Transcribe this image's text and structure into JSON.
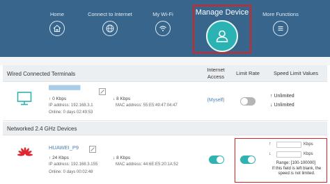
{
  "nav": {
    "items": [
      {
        "label": "Home",
        "icon": "home-icon"
      },
      {
        "label": "Connect to Internet",
        "icon": "globe-icon"
      },
      {
        "label": "My Wi-Fi",
        "icon": "wifi-icon"
      },
      {
        "label": "Manage Device",
        "icon": "user-icon"
      },
      {
        "label": "More Functions",
        "icon": "menu-icon"
      }
    ]
  },
  "table": {
    "columns": {
      "internet_access": "Internet Access",
      "limit_rate": "Limit Rate",
      "speed_limit_values": "Speed Limit Values"
    },
    "sections": [
      {
        "title": "Wired Connected Terminals",
        "devices": [
          {
            "name": "████████████",
            "icon": "monitor-icon",
            "upload": "0 Kbps",
            "download": "8 Kbps",
            "ip_label": "IP address: 192.168.3.1",
            "mac_label": "MAC address: 55:E5:49:47:04:47",
            "online_label": "Online:  0 days 02:49:53",
            "internet_access": "(Myself)",
            "limit_rate_on": false,
            "speed_up": "Unlimited",
            "speed_down": "Unlimited"
          }
        ]
      },
      {
        "title": "Networked 2.4 GHz Devices",
        "devices": [
          {
            "name": "HUAWEI_P9",
            "icon": "huawei-logo",
            "upload": "24 Kbps",
            "download": "8 Kbps",
            "ip_label": "IP address: 192.168.3.155",
            "mac_label": "MAC address: 44:6E:E5:20:1A:52",
            "online_label": "Online:  0 days 00:02:48",
            "internet_access_on": true,
            "limit_rate_on": true,
            "limit_up_value": "",
            "limit_down_value": "",
            "unit": "Kbps",
            "range": "Range: [100-100000]",
            "hint": "If this field is left blank, the speed is not limited."
          }
        ]
      }
    ]
  },
  "colors": {
    "topbar": "#37658c",
    "accent": "#2fb3b0",
    "highlight": "#e02020",
    "link": "#4a7fb5"
  }
}
